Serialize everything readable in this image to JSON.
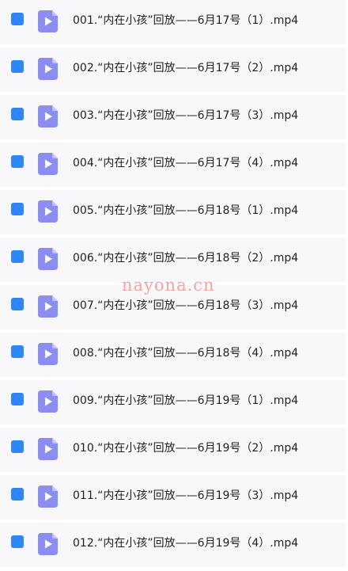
{
  "files": [
    {
      "name": "001.“内在小孩”回放——6月17号（1）.mp4",
      "icon": "video-file-icon",
      "selected": true
    },
    {
      "name": "002.“内在小孩”回放——6月17号（2）.mp4",
      "icon": "video-file-icon",
      "selected": true
    },
    {
      "name": "003.“内在小孩”回放——6月17号（3）.mp4",
      "icon": "video-file-icon",
      "selected": true
    },
    {
      "name": "004.“内在小孩”回放——6月17号（4）.mp4",
      "icon": "video-file-icon",
      "selected": true
    },
    {
      "name": "005.“内在小孩”回放——6月18号（1）.mp4",
      "icon": "video-file-icon",
      "selected": true
    },
    {
      "name": "006.“内在小孩”回放——6月18号（2）.mp4",
      "icon": "video-file-icon",
      "selected": true
    },
    {
      "name": "007.“内在小孩”回放——6月18号（3）.mp4",
      "icon": "video-file-icon",
      "selected": true
    },
    {
      "name": "008.“内在小孩”回放——6月18号（4）.mp4",
      "icon": "video-file-icon",
      "selected": true
    },
    {
      "name": "009.“内在小孩”回放——6月19号（1）.mp4",
      "icon": "video-file-icon",
      "selected": true
    },
    {
      "name": "010.“内在小孩”回放——6月19号（2）.mp4",
      "icon": "video-file-icon",
      "selected": true
    },
    {
      "name": "011.“内在小孩”回放——6月19号（3）.mp4",
      "icon": "video-file-icon",
      "selected": true
    },
    {
      "name": "012.“内在小孩”回放——6月19号（4）.mp4",
      "icon": "video-file-icon",
      "selected": true
    }
  ],
  "watermark": "nayona.cn",
  "colors": {
    "checkbox": "#2f86f6",
    "icon_back": "#a7a8f4",
    "icon_front": "#8b8ef0",
    "row_bg": "#f8f8fb",
    "watermark": "#f1a5a5"
  }
}
